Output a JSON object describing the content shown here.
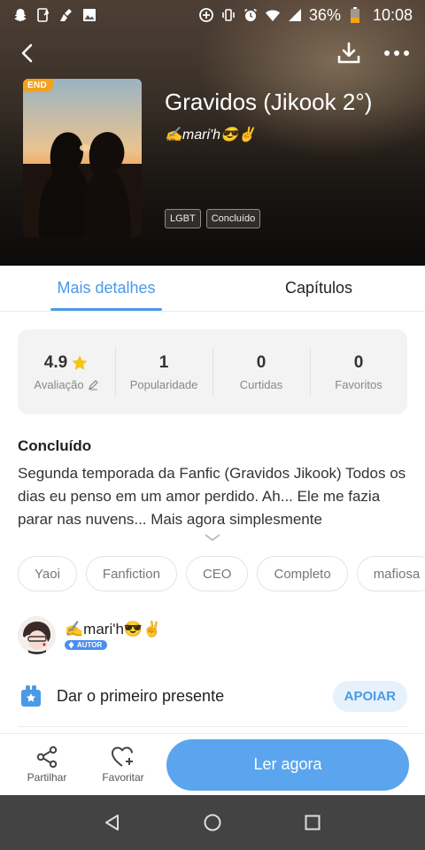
{
  "status_bar": {
    "battery_percent": "36%",
    "time": "10:08"
  },
  "book": {
    "title": "Gravidos (Jikook 2°)",
    "author": "✍mari'h😎✌",
    "cover_badge": "END",
    "tags": [
      "LGBT",
      "Concluído"
    ]
  },
  "tabs": [
    "Mais detalhes",
    "Capítulos"
  ],
  "active_tab": "Mais detalhes",
  "stats": [
    {
      "value": "4.9",
      "label": "Avaliação"
    },
    {
      "value": "1",
      "label": "Popularidade"
    },
    {
      "value": "0",
      "label": "Curtidas"
    },
    {
      "value": "0",
      "label": "Favoritos"
    }
  ],
  "synopsis": {
    "status_title": "Concluído",
    "text": "Segunda temporada da Fanfic (Gravidos Jikook) Todos os dias eu penso em um amor perdido. Ah... Ele me fazia parar nas nuvens... Mais agora simplesmente"
  },
  "genre_tags": [
    "Yaoi",
    "Fanfiction",
    "CEO",
    "Completo",
    "mafiosa"
  ],
  "author_section": {
    "name": "✍mari'h😎✌",
    "badge": "AUTOR"
  },
  "gift": {
    "text": "Dar o primeiro presente",
    "button": "APOIAR"
  },
  "action_bar": {
    "share_label": "Partilhar",
    "favorite_label": "Favoritar",
    "read_label": "Ler agora"
  },
  "colors": {
    "accent": "#4a9ae6",
    "read_button": "#5aa5ee",
    "end_badge": "#f2a21c",
    "star": "#f5c518"
  }
}
